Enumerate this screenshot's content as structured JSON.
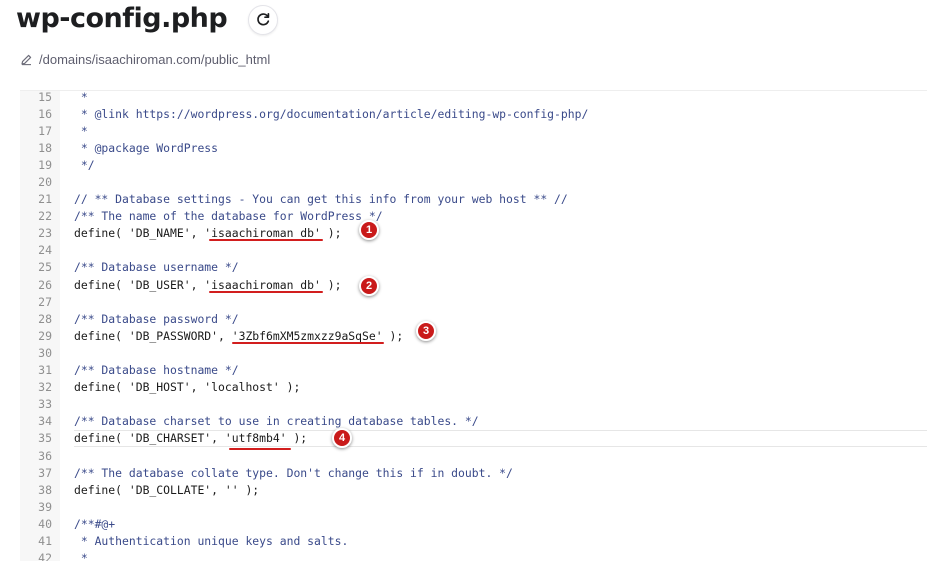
{
  "header": {
    "title": "wp-config.php",
    "path": "/domains/isaachiroman.com/public_html"
  },
  "icons": {
    "refresh": "refresh-icon",
    "edit": "pencil-icon"
  },
  "colors": {
    "annotation_red": "#c91a1a"
  },
  "editor": {
    "lines": [
      {
        "n": "15",
        "t": " *"
      },
      {
        "n": "16",
        "t": " * @link https://wordpress.org/documentation/article/editing-wp-config-php/"
      },
      {
        "n": "17",
        "t": " *"
      },
      {
        "n": "18",
        "t": " * @package WordPress"
      },
      {
        "n": "19",
        "t": " */"
      },
      {
        "n": "20",
        "t": ""
      },
      {
        "n": "21",
        "t": "// ** Database settings - You can get this info from your web host ** //"
      },
      {
        "n": "22",
        "t": "/** The name of the database for WordPress */"
      },
      {
        "n": "23",
        "t": "define( 'DB_NAME', 'isaachiroman_db' );"
      },
      {
        "n": "24",
        "t": ""
      },
      {
        "n": "25",
        "t": "/** Database username */"
      },
      {
        "n": "26",
        "t": "define( 'DB_USER', 'isaachiroman_db' );"
      },
      {
        "n": "27",
        "t": ""
      },
      {
        "n": "28",
        "t": "/** Database password */"
      },
      {
        "n": "29",
        "t": "define( 'DB_PASSWORD', '3Zbf6mXM5zmxzz9aSqSe' );"
      },
      {
        "n": "30",
        "t": ""
      },
      {
        "n": "31",
        "t": "/** Database hostname */"
      },
      {
        "n": "32",
        "t": "define( 'DB_HOST', 'localhost' );"
      },
      {
        "n": "33",
        "t": ""
      },
      {
        "n": "34",
        "t": "/** Database charset to use in creating database tables. */"
      },
      {
        "n": "35",
        "t": "define( 'DB_CHARSET', 'utf8mb4' );"
      },
      {
        "n": "36",
        "t": ""
      },
      {
        "n": "37",
        "t": "/** The database collate type. Don't change this if in doubt. */"
      },
      {
        "n": "38",
        "t": "define( 'DB_COLLATE', '' );"
      },
      {
        "n": "39",
        "t": ""
      },
      {
        "n": "40",
        "t": "/**#@+"
      },
      {
        "n": "41",
        "t": " * Authentication unique keys and salts."
      },
      {
        "n": "42",
        "t": " *"
      }
    ]
  },
  "annotations": {
    "a1": "1",
    "a2": "2",
    "a3": "3",
    "a4": "4"
  }
}
